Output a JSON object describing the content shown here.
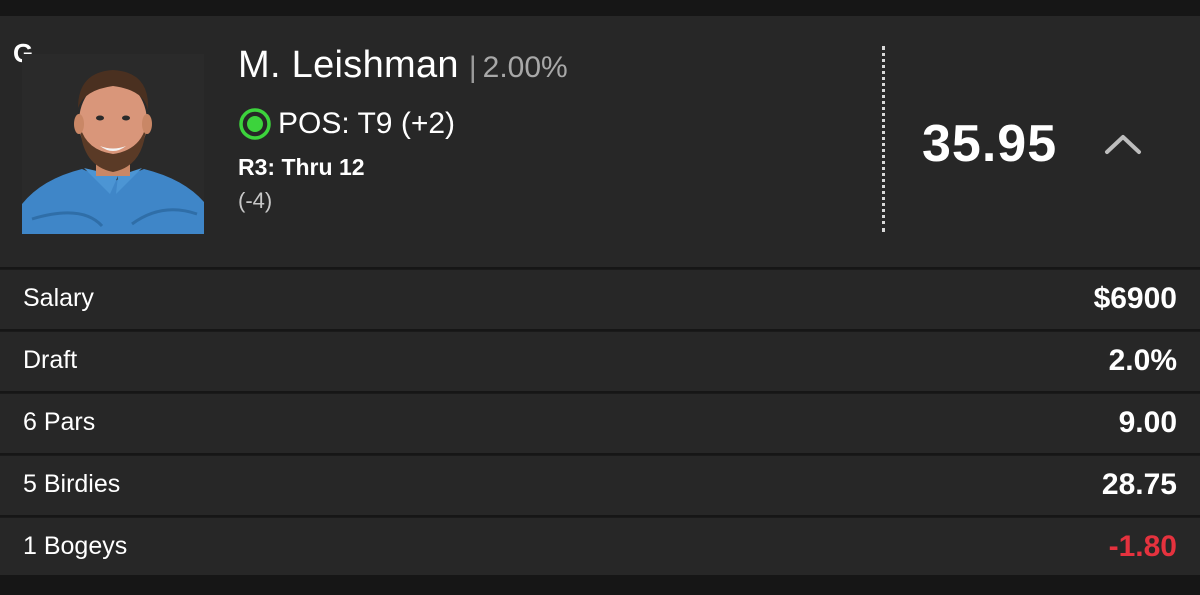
{
  "player": {
    "position": "G",
    "name": "M. Leishman",
    "separator": "|",
    "ownership": "2.00%",
    "status_color": "#3cd33c",
    "tournament_position": "POS: T9 (+2)",
    "round_status": "R3: Thru 12",
    "round_score": "(-4)",
    "total_points": "35.95",
    "expand_icon": "chevron-up-icon"
  },
  "stats": [
    {
      "label": "Salary",
      "value": "$6900",
      "negative": false
    },
    {
      "label": "Draft",
      "value": "2.0%",
      "negative": false
    },
    {
      "label": "6 Pars",
      "value": "9.00",
      "negative": false
    },
    {
      "label": "5 Birdies",
      "value": "28.75",
      "negative": false
    },
    {
      "label": "1 Bogeys",
      "value": "-1.80",
      "negative": true
    }
  ],
  "colors": {
    "background": "#161616",
    "card": "#272727",
    "negative": "#e5323e",
    "muted": "#a8a8a8"
  }
}
